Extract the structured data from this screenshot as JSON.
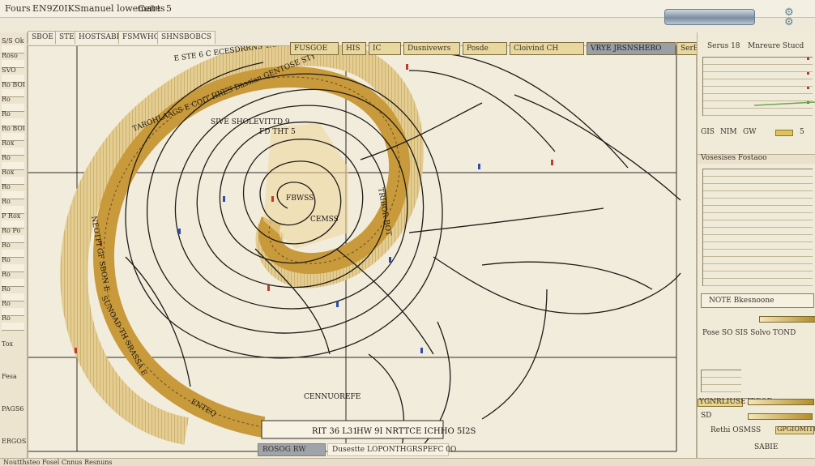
{
  "window": {
    "title_left": "Fours",
    "title_mid": "EN9Z0IKSmanuel lowemates",
    "title_right": "Ceirt",
    "title_num": "5"
  },
  "left_panel": {
    "labels": [
      "S/S Ok",
      "Roso",
      "SVO",
      "Ro BOI",
      "Ro",
      "Ro",
      "Ro BOI",
      "Rox",
      "Ro",
      "Rox",
      "Ro",
      "Ro",
      "P Rox",
      "Ro Po",
      "Ro",
      "Ro",
      "Ro",
      "Ro",
      "Ro",
      "Ro"
    ],
    "bottom_labels": [
      "Tox",
      "Fesa",
      "PAGS6",
      "ERGOS"
    ]
  },
  "tabs": [
    "SBOE",
    "STE",
    "HOSTSABRTOS",
    "FSMWHORS",
    "SHNSBOBCS"
  ],
  "toolbar": {
    "items": [
      "FUSGOE",
      "HIS",
      "IC",
      "Dusnivewrs",
      "Posde",
      "Cloivind CH",
      "VRYE JRSNSHERO",
      "SerBS"
    ]
  },
  "spiral_labels": {
    "outer_top": "E STE 6 C ECESDRRNS TAT7I IESCSIRDT",
    "upper_arc": "TAROHLAAGS E COIT HRES Dassian GENTOSE STY",
    "inner_top": "SIVE SHOLEVITTD 9",
    "mid_left": "FD THT 5",
    "center": "FBWSS",
    "mid_right": "CEMSS",
    "right_band": "TRIBOR BOT",
    "left_band": "NEOTPI GF SBON E",
    "lower_band": "SUNOAD TH SRASSA E",
    "bottom_note": "CENNUOREFE",
    "bottom_tag": "ENTEQ"
  },
  "canvas_bottom": {
    "left_box": "RIT 36 L31",
    "right_box": "HW 9I NRTTCE ICHHO 5I2S"
  },
  "status": {
    "left": "ROSOG RW",
    "right": "Dusestte LOPONTHGRSPEFC 0O"
  },
  "right_panel": {
    "header": [
      "Serus 18",
      "Mnreure Stucd"
    ],
    "controls": [
      "GIS",
      "NIM",
      "GW",
      "5"
    ],
    "section1": "Vosesises Fostaoo",
    "section2": "NOTE Bkesnoone",
    "row_a": "Pose SO SIS Solvo TOND",
    "row_b": "YGNRLIUSETPEQE",
    "row_c": "SD",
    "row_d": "Rethi OSMSS",
    "row_e": "GPGIOMITE",
    "row_f": "SABIE"
  },
  "footer": "Noutthsteo Fosel Cnnus Resnuns",
  "colors": {
    "band_gold": "#c89a3b",
    "band_light": "#e6c77a",
    "spiral_line": "#1e1b17",
    "grid_line": "#2b2721",
    "marker_red": "#c23a2a",
    "marker_blue": "#2f4da8"
  }
}
